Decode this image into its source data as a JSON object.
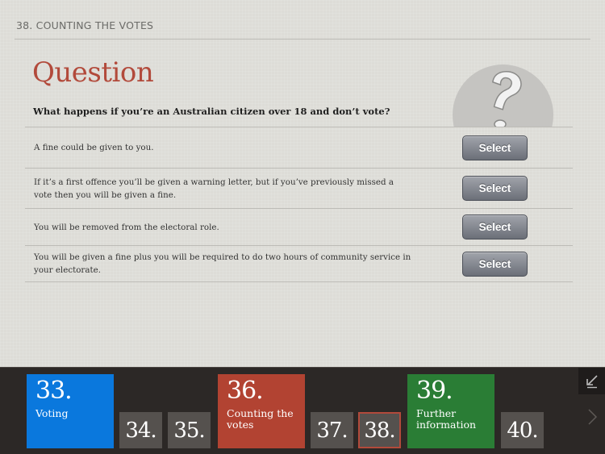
{
  "header": {
    "title": "38.  COUNTING THE VOTES"
  },
  "question": {
    "heading": "Question",
    "text": "What happens if you’re an Australian citizen over 18 and don’t vote?",
    "illustration_icon": "question-mark-icon"
  },
  "answers": [
    {
      "text": "A fine could be given to you.",
      "button_label": "Select"
    },
    {
      "text": "If it’s a first offence you’ll be given a warning letter, but if you’ve previously missed a vote then you will be given a fine.",
      "button_label": "Select"
    },
    {
      "text": "You will be removed from the electoral role.",
      "button_label": "Select"
    },
    {
      "text": "You will be given a fine plus you will be required to do two hours of community service in your electorate.",
      "button_label": "Select"
    }
  ],
  "nav": {
    "tiles": [
      {
        "number": "33.",
        "label": "Voting",
        "color": "#0a78dd",
        "type": "section"
      },
      {
        "number": "34.",
        "label": "",
        "color": "#55514e",
        "type": "page"
      },
      {
        "number": "35.",
        "label": "",
        "color": "#55514e",
        "type": "page"
      },
      {
        "number": "36.",
        "label": "Counting the votes",
        "color": "#b24332",
        "type": "section"
      },
      {
        "number": "37.",
        "label": "",
        "color": "#55514e",
        "type": "page"
      },
      {
        "number": "38.",
        "label": "",
        "color": "#55514e",
        "type": "page",
        "current": true
      },
      {
        "number": "39.",
        "label": "Further information",
        "color": "#2a7d35",
        "type": "section"
      },
      {
        "number": "40.",
        "label": "",
        "color": "#55514e",
        "type": "page"
      }
    ],
    "corner_icon": "collapse-arrow-icon",
    "next_icon": "chevron-right-icon",
    "current_color": "#b24a3b"
  }
}
